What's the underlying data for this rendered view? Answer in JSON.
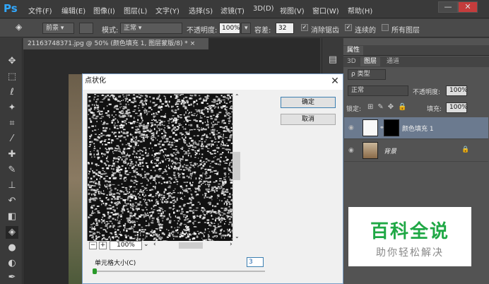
{
  "app": {
    "logo": "Ps"
  },
  "menu": [
    "文件(F)",
    "编辑(E)",
    "图像(I)",
    "图层(L)",
    "文字(Y)",
    "选择(S)",
    "滤镜(T)",
    "3D(D)",
    "视图(V)",
    "窗口(W)",
    "帮助(H)"
  ],
  "window_controls": {
    "minimize": "—",
    "maximize": "□",
    "close": "✕"
  },
  "options": {
    "fill_source": "前景",
    "mode_label": "模式:",
    "mode_value": "正常",
    "opacity_label": "不透明度:",
    "opacity_value": "100%",
    "tolerance_label": "容差:",
    "tolerance_value": "32",
    "antialias_label": "消除锯齿",
    "antialias_checked": true,
    "contiguous_label": "连续的",
    "contiguous_checked": true,
    "all_layers_label": "所有图层",
    "all_layers_checked": false
  },
  "document": {
    "tab_title": "21163748371.jpg @ 50% (颜色填充 1, 图层蒙版/8) *",
    "tab_close": "×"
  },
  "dialog": {
    "title": "点状化",
    "close": "✕",
    "ok_label": "确定",
    "cancel_label": "取消",
    "zoom_value": "100%",
    "zoom_out": "−",
    "zoom_in": "+",
    "cell_size_label": "单元格大小(C)",
    "cell_size_value": "3"
  },
  "panels": {
    "properties_tab": "属性",
    "tabs": [
      "3D",
      "图层",
      "通道"
    ],
    "active_tab": "图层",
    "filter_kind": "ρ 类型",
    "blend_mode": "正常",
    "opacity_label": "不透明度:",
    "opacity_value": "100%",
    "lock_label": "锁定:",
    "fill_label": "填充:",
    "fill_value": "100%",
    "layers": [
      {
        "name": "颜色填充 1",
        "selected": true
      },
      {
        "name": "背景",
        "selected": false
      }
    ]
  },
  "watermark": {
    "title": "百科全说",
    "subtitle": "助你轻松解决"
  },
  "colors": {
    "accent": "#31a8ff",
    "watermark_green": "#1fa845",
    "selected_layer": "#6b7a8f"
  }
}
